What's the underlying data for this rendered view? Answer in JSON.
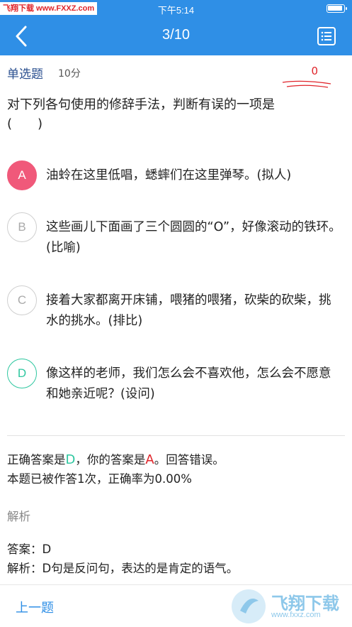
{
  "status_bar": {
    "watermark": "飞翔下载 www.FXXZ.com",
    "time": "下午5:14"
  },
  "nav": {
    "title": "3/10",
    "back_icon": "chevron-left-icon",
    "list_icon": "list-icon"
  },
  "question_meta": {
    "type": "单选题",
    "score": "10分",
    "earned": "0"
  },
  "question": {
    "text": "对下列各句使用的修辞手法，判断有误的一项是",
    "blank": "(　　)"
  },
  "options": [
    {
      "letter": "A",
      "text": "油蛉在这里低唱，蟋蟀们在这里弹琴。(拟人)",
      "state": "wrong"
    },
    {
      "letter": "B",
      "text": "这些画儿下面画了三个圆圆的“O”，好像滚动的铁环。(比喻)",
      "state": "normal"
    },
    {
      "letter": "C",
      "text": "接着大家都离开床铺，喂猪的喂猪，砍柴的砍柴，挑水的挑水。(排比)",
      "state": "normal"
    },
    {
      "letter": "D",
      "text": "像这样的老师，我们怎么会不喜欢他，怎么会不愿意和她亲近呢？(设问)",
      "state": "correct"
    }
  ],
  "result": {
    "correct_prefix": "正确答案是",
    "correct_answer": "D",
    "your_prefix": "，你的答案是",
    "your_answer": "A",
    "verdict": "。回答错误。",
    "stats": "本题已被作答1次，正确率为0.00%"
  },
  "analysis": {
    "title": "解析",
    "answer_line": "答案：D",
    "explanation_line": "解析：D句是反问句，表达的是肯定的语气。"
  },
  "bottom": {
    "prev_label": "上一题",
    "watermark_text": "飞翔下载",
    "watermark_url": "www.fxxz.com"
  },
  "colors": {
    "primary": "#2f8fe6",
    "wrong": "#f0597a",
    "correct": "#2fc7a0",
    "score": "#e0242a"
  }
}
